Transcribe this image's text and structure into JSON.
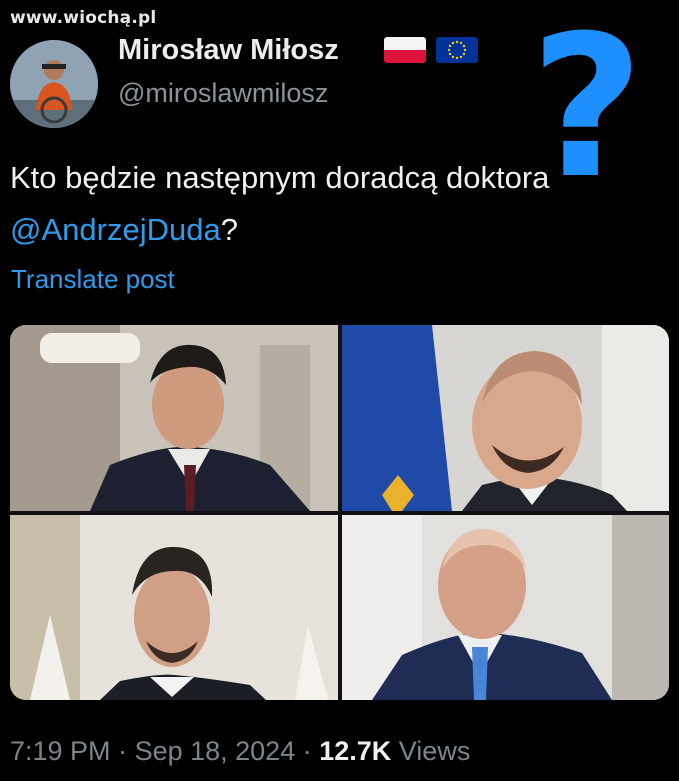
{
  "watermark": "www.wiochą.pl",
  "author": {
    "display_name": "Mirosław Miłosz",
    "handle": "@miroslawmilosz"
  },
  "overlay": {
    "question_mark": "?"
  },
  "post": {
    "text_before": "Kto będzie następnym doradcą doktora ",
    "mention": "@AndrzejDuda",
    "text_after": "?",
    "translate_label": "Translate post"
  },
  "meta": {
    "time": "7:19 PM",
    "sep1": " · ",
    "date": "Sep 18, 2024",
    "sep2": " · ",
    "views_count": "12.7K",
    "views_label": " Views"
  },
  "colors": {
    "background": "#000000",
    "link": "#2f9ceb",
    "accent_question": "#1e8fff",
    "muted": "#7d848a"
  }
}
